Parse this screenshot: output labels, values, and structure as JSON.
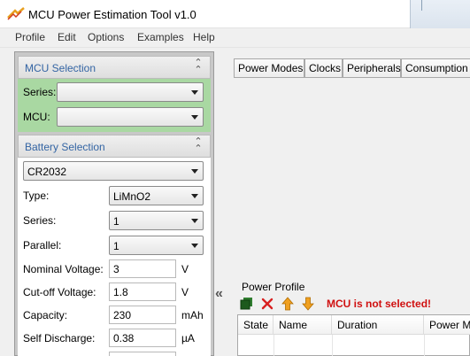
{
  "window": {
    "title": "MCU Power Estimation Tool v1.0",
    "icon": "app-logo-icon"
  },
  "menubar": {
    "items": [
      "Profile",
      "Edit",
      "Options",
      "Examples",
      "Help"
    ]
  },
  "mcu_selection": {
    "title": "MCU Selection",
    "series_label": "Series:",
    "series_value": "",
    "mcu_label": "MCU:",
    "mcu_value": ""
  },
  "battery_selection": {
    "title": "Battery Selection",
    "battery_value": "CR2032",
    "type_label": "Type:",
    "type_value": "LiMnO2",
    "series_label": "Series:",
    "series_value": "1",
    "parallel_label": "Parallel:",
    "parallel_value": "1",
    "nominal_voltage_label": "Nominal Voltage:",
    "nominal_voltage_value": "3",
    "nominal_voltage_unit": "V",
    "cutoff_voltage_label": "Cut-off Voltage:",
    "cutoff_voltage_value": "1.8",
    "cutoff_voltage_unit": "V",
    "capacity_label": "Capacity:",
    "capacity_value": "230",
    "capacity_unit": "mAh",
    "self_discharge_label": "Self Discharge:",
    "self_discharge_value": "0.38",
    "self_discharge_unit": "µA"
  },
  "tabs": [
    "Power Modes",
    "Clocks",
    "Peripherals",
    "Consumption"
  ],
  "power_profile": {
    "title": "Power Profile",
    "error": "MCU is not selected!",
    "columns": [
      "State",
      "Name",
      "Duration",
      "Power M"
    ]
  },
  "colors": {
    "section_header_text": "#3465a4",
    "mcu_panel_bg": "#a9d8a2",
    "error": "#d01010"
  }
}
